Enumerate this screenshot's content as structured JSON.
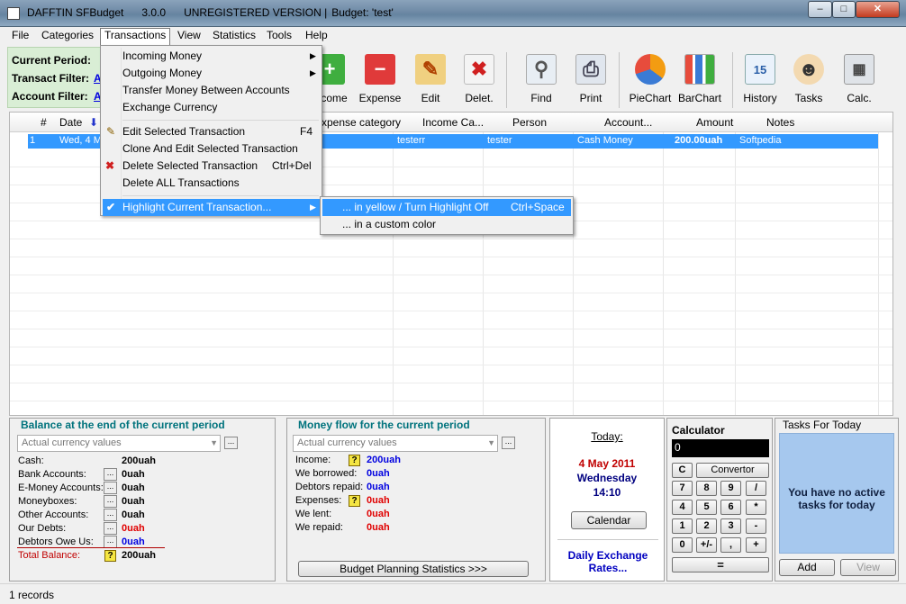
{
  "window": {
    "title": "DAFFTIN SFBudget",
    "version": "3.0.0",
    "registration": "UNREGISTERED VERSION |",
    "budget": "Budget: 'test'"
  },
  "menubar": [
    "File",
    "Categories",
    "Transactions",
    "View",
    "Statistics",
    "Tools",
    "Help"
  ],
  "filters": {
    "period_label": "Current Period:",
    "transact_label": "Transact Filter:",
    "account_label": "Account Filter:",
    "link_text": "A"
  },
  "toolbar": [
    "Income",
    "Expense",
    "Edit",
    "Delet.",
    "Find",
    "Print",
    "PieChart",
    "BarChart",
    "History",
    "Tasks",
    "Calc."
  ],
  "grid": {
    "columns": [
      "#",
      "Date",
      "Expense category",
      "Income Ca...",
      "Person",
      "Account...",
      "Amount",
      "Notes"
    ],
    "row": {
      "num": "1",
      "date": "Wed, 4 M",
      "income_cat": "testerr",
      "person": "tester",
      "account": "Cash Money",
      "amount": "200.00uah",
      "notes": "Softpedia"
    }
  },
  "transactions_menu": {
    "items": [
      "Incoming Money",
      "Outgoing Money",
      "Transfer Money Between Accounts",
      "Exchange Currency",
      "Edit Selected Transaction",
      "Clone And Edit Selected Transaction",
      "Delete Selected Transaction",
      "Delete ALL Transactions",
      "Highlight Current Transaction..."
    ],
    "shortcuts": {
      "edit": "F4",
      "delete": "Ctrl+Del"
    }
  },
  "highlight_submenu": {
    "items": [
      "... in yellow / Turn Highlight Off",
      "... in a custom color"
    ],
    "shortcut": "Ctrl+Space"
  },
  "balance": {
    "title": "Balance at the end of the current period",
    "combo": "Actual currency values",
    "rows": [
      {
        "label": "Cash:",
        "value": "200uah"
      },
      {
        "label": "Bank Accounts:",
        "value": "0uah"
      },
      {
        "label": "E-Money Accounts:",
        "value": "0uah"
      },
      {
        "label": "Moneyboxes:",
        "value": "0uah"
      },
      {
        "label": "Other Accounts:",
        "value": "0uah"
      },
      {
        "label": "Our Debts:",
        "value": "0uah"
      },
      {
        "label": "Debtors Owe Us:",
        "value": "0uah"
      }
    ],
    "total_label": "Total Balance:",
    "total_value": "200uah"
  },
  "moneyflow": {
    "title": "Money flow for the current period",
    "combo": "Actual currency values",
    "rows": [
      {
        "label": "Income:",
        "value": "200uah"
      },
      {
        "label": "We borrowed:",
        "value": "0uah"
      },
      {
        "label": "Debtors repaid:",
        "value": "0uah"
      },
      {
        "label": "Expenses:",
        "value": "0uah"
      },
      {
        "label": "We lent:",
        "value": "0uah"
      },
      {
        "label": "We repaid:",
        "value": "0uah"
      }
    ],
    "button": "Budget Planning Statistics >>>"
  },
  "today": {
    "label": "Today:",
    "date": "4 May 2011",
    "weekday": "Wednesday",
    "time": "14:10",
    "calendar_button": "Calendar",
    "rates_link": "Daily Exchange Rates..."
  },
  "calculator": {
    "title": "Calculator",
    "display": "0",
    "clear": "C",
    "convertor": "Convertor",
    "keys": [
      "7",
      "8",
      "9",
      "/",
      "4",
      "5",
      "6",
      "*",
      "1",
      "2",
      "3",
      "-",
      "0",
      "+/-",
      ",",
      "+"
    ],
    "equals": "="
  },
  "tasks": {
    "title": "Tasks For Today",
    "message": "You have no active tasks for today",
    "add": "Add",
    "view": "View"
  },
  "status": {
    "records": "1 records"
  },
  "colors": {
    "selection": "#3399ff",
    "label_teal": "#00737d",
    "value_blue": "#0000e0",
    "value_red": "#e00000",
    "date_red": "#c00000",
    "date_navy": "#000080"
  }
}
